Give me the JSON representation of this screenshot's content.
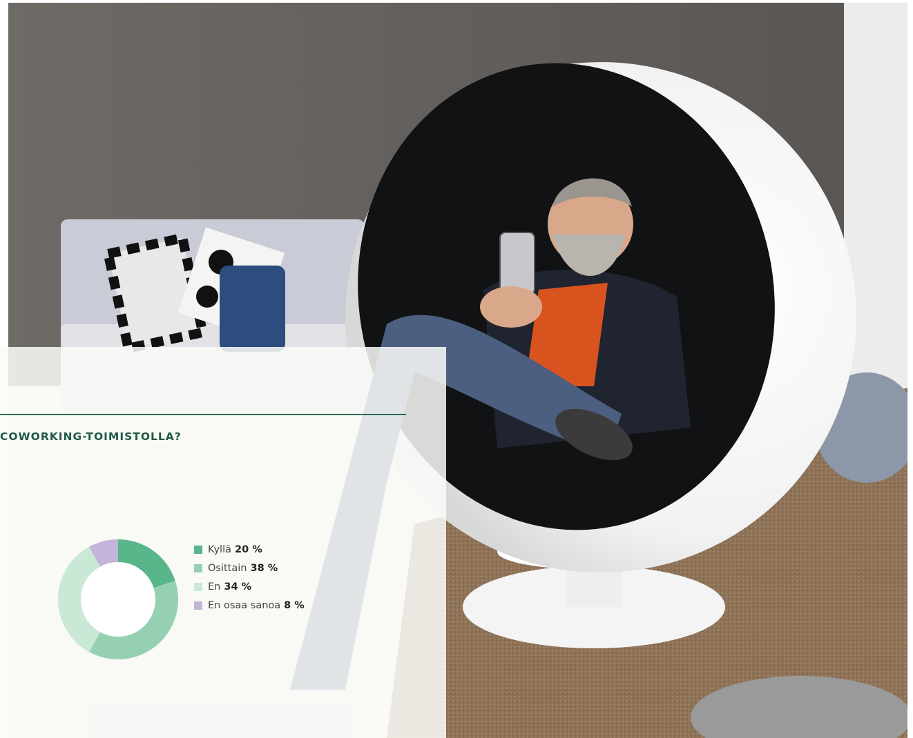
{
  "photo": {
    "description_icon": "person-in-ball-chair-photo"
  },
  "panel": {
    "question": "COWORKING-TOIMISTOLLA?"
  },
  "chart_data": {
    "type": "pie",
    "donut": true,
    "title": "",
    "categories": [
      "Kyllä",
      "Osittain",
      "En",
      "En osaa sanoa"
    ],
    "values": [
      20,
      38,
      34,
      8
    ],
    "value_labels": [
      "20 %",
      "38 %",
      "34 %",
      "8 %"
    ],
    "colors": [
      "#58b68a",
      "#96d0b2",
      "#c9e8d6",
      "#c3b5da"
    ],
    "legend_position": "right"
  }
}
